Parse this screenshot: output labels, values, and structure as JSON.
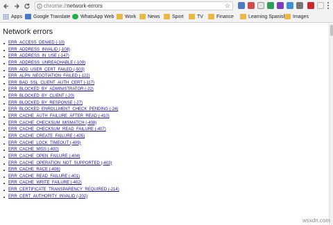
{
  "toolbar": {
    "url_scheme": "chrome://",
    "url_path": "network-errors",
    "star": "☆"
  },
  "bookmarks": [
    {
      "label": "Apps",
      "icon": "apps-icon"
    },
    {
      "label": "Google Translate",
      "icon": "translate-icon"
    },
    {
      "label": "WhatsApp Web",
      "icon": "whatsapp-icon"
    },
    {
      "label": "Work",
      "icon": "folder-icon"
    },
    {
      "label": "News",
      "icon": "folder-icon"
    },
    {
      "label": "Sport",
      "icon": "folder-icon"
    },
    {
      "label": "TV",
      "icon": "folder-icon"
    },
    {
      "label": "Finance",
      "icon": "folder-icon"
    },
    {
      "label": "Learning Spanish",
      "icon": "folder-icon"
    },
    {
      "label": "Images",
      "icon": "folder-icon"
    }
  ],
  "page": {
    "title": "Network errors",
    "errors": [
      "ERR_ACCESS_DENIED (-10)",
      "ERR_ADDRESS_INVALID (-108)",
      "ERR_ADDRESS_IN_USE (-147)",
      "ERR_ADDRESS_UNREACHABLE (-109)",
      "ERR_ADD_USER_CERT_FAILED (-503)",
      "ERR_ALPN_NEGOTIATION_FAILED (-122)",
      "ERR_BAD_SSL_CLIENT_AUTH_CERT (-117)",
      "ERR_BLOCKED_BY_ADMINISTRATOR (-22)",
      "ERR_BLOCKED_BY_CLIENT (-20)",
      "ERR_BLOCKED_BY_RESPONSE (-27)",
      "ERR_BLOCKED_ENROLLMENT_CHECK_PENDING (-24)",
      "ERR_CACHE_AUTH_FAILURE_AFTER_READ (-410)",
      "ERR_CACHE_CHECKSUM_MISMATCH (-408)",
      "ERR_CACHE_CHECKSUM_READ_FAILURE (-407)",
      "ERR_CACHE_CREATE_FAILURE (-405)",
      "ERR_CACHE_LOCK_TIMEOUT (-409)",
      "ERR_CACHE_MISS (-400)",
      "ERR_CACHE_OPEN_FAILURE (-404)",
      "ERR_CACHE_OPERATION_NOT_SUPPORTED (-403)",
      "ERR_CACHE_RACE (-406)",
      "ERR_CACHE_READ_FAILURE (-401)",
      "ERR_CACHE_WRITE_FAILURE (-402)",
      "ERR_CERTIFICATE_TRANSPARENCY_REQUIRED (-214)",
      "ERR_CERT_AUTHORITY_INVALID (-202)"
    ]
  },
  "watermark": "wsxdn.com"
}
